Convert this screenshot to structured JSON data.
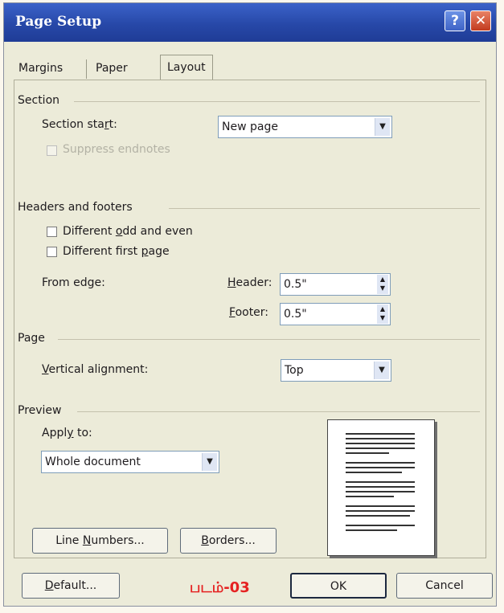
{
  "window": {
    "title": "Page Setup",
    "help_glyph": "?",
    "close_glyph": "✕"
  },
  "tabs": [
    {
      "label": "Margins"
    },
    {
      "label": "Paper"
    },
    {
      "label": "Layout",
      "active": true
    }
  ],
  "section": {
    "heading": "Section",
    "start_label": "Section start:",
    "start_value": "New page",
    "suppress_label": "Suppress endnotes"
  },
  "headers_footers": {
    "heading": "Headers and footers",
    "odd_even_label": "Different odd and even",
    "first_page_label": "Different first page",
    "from_edge_label": "From edge:",
    "header_label": "Header:",
    "header_value": "0.5\"",
    "footer_label": "Footer:",
    "footer_value": "0.5\""
  },
  "page": {
    "heading": "Page",
    "valign_label": "Vertical alignment:",
    "valign_value": "Top"
  },
  "preview": {
    "heading": "Preview",
    "apply_label": "Apply to:",
    "apply_value": "Whole document"
  },
  "buttons": {
    "line_numbers": "Line Numbers...",
    "borders": "Borders...",
    "default": "Default...",
    "ok": "OK",
    "cancel": "Cancel"
  },
  "caption": "படம்-03",
  "colors": {
    "titlebar": "#2748a8",
    "close": "#c23a1e",
    "caption": "#e52222"
  }
}
